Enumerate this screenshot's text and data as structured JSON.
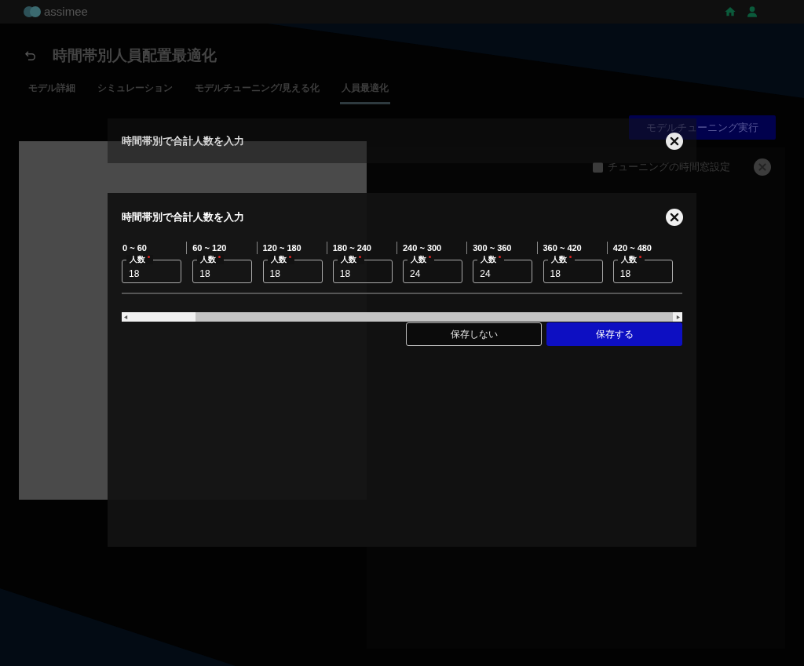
{
  "header": {
    "logo": "assimee"
  },
  "page": {
    "title": "時間帯別人員配置最適化"
  },
  "tabs": [
    {
      "label": "モデル詳細",
      "selected": false
    },
    {
      "label": "シミュレーション",
      "selected": false
    },
    {
      "label": "モデルチューニング/見える化",
      "selected": false
    },
    {
      "label": "人員最適化",
      "selected": true
    }
  ],
  "tuning_button": "モデルチューニング実行",
  "time_window": {
    "label": "チューニングの時間窓設定",
    "checked": false
  },
  "back_dialog": {
    "title": "時間帯別で合計人数を入力"
  },
  "dialog": {
    "title": "時間帯別で合計人数を入力",
    "slots": [
      {
        "range": "0 ~ 60",
        "label": "人数",
        "required": true,
        "value": "18"
      },
      {
        "range": "60 ~ 120",
        "label": "人数",
        "required": true,
        "value": "18"
      },
      {
        "range": "120 ~ 180",
        "label": "人数",
        "required": true,
        "value": "18"
      },
      {
        "range": "180 ~ 240",
        "label": "人数",
        "required": true,
        "value": "18"
      },
      {
        "range": "240 ~ 300",
        "label": "人数",
        "required": true,
        "value": "24"
      },
      {
        "range": "300 ~ 360",
        "label": "人数",
        "required": true,
        "value": "24"
      },
      {
        "range": "360 ~ 420",
        "label": "人数",
        "required": true,
        "value": "18"
      },
      {
        "range": "420 ~ 480",
        "label": "人数",
        "required": true,
        "value": "18"
      }
    ],
    "buttons": [
      {
        "label": "保存しない",
        "kind": "secondary"
      },
      {
        "label": "保存する",
        "kind": "primary"
      }
    ]
  }
}
